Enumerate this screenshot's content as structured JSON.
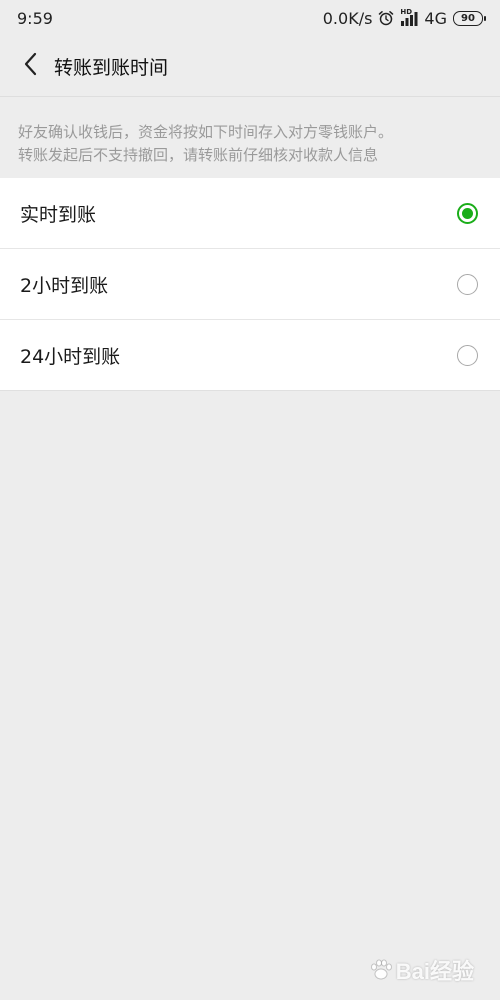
{
  "status_bar": {
    "time": "9:59",
    "net_speed": "0.0K/s",
    "hd_label": "HD",
    "network": "4G",
    "battery": "90",
    "icons": [
      "alarm-icon",
      "signal-icon"
    ]
  },
  "header": {
    "back_icon": "chevron-left-icon",
    "title": "转账到账时间"
  },
  "description": {
    "line1": "好友确认收钱后，资金将按如下时间存入对方零钱账户。",
    "line2": "转账发起后不支持撤回，请转账前仔细核对收款人信息"
  },
  "options": [
    {
      "label": "实时到账",
      "selected": true
    },
    {
      "label": "2小时到账",
      "selected": false
    },
    {
      "label": "24小时到账",
      "selected": false
    }
  ],
  "colors": {
    "accent": "#1aad19",
    "background": "#ededed",
    "hint_text": "#9a9a9a"
  },
  "watermark": {
    "text": "Bai经验",
    "icon": "paw-icon"
  }
}
